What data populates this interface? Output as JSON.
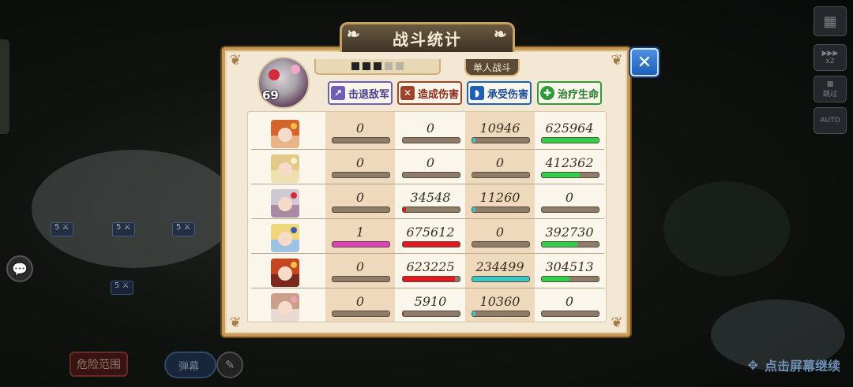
{
  "title": "战斗统计",
  "mode_badge": "单人战斗",
  "player_name_redacted": true,
  "hero_level": "69",
  "close_glyph": "✕",
  "tabs": {
    "kill": {
      "label": "击退敌军",
      "icon": "boot-icon",
      "color": "#6d5fb5"
    },
    "dealt": {
      "label": "造成伤害",
      "icon": "crossed-swords-icon",
      "color": "#a0432b"
    },
    "taken": {
      "label": "承受伤害",
      "icon": "shield-icon",
      "color": "#1e5fb8"
    },
    "heal": {
      "label": "治疗生命",
      "icon": "plus-cross-icon",
      "color": "#2f9a3a"
    }
  },
  "bar_colors": {
    "kill": "#e03fbe",
    "dealt": "#e3161c",
    "taken": "#37c8c9",
    "heal": "#2fd04a"
  },
  "units": [
    {
      "name": "unit-1",
      "portrait": {
        "hair": "#d4642a",
        "acc": "#f2c14a",
        "bg": "#e8b48a"
      },
      "kill": {
        "value": "0",
        "ratio": 0
      },
      "dealt": {
        "value": "0",
        "ratio": 0
      },
      "taken": {
        "value": "10946",
        "ratio": 0.06
      },
      "heal": {
        "value": "625964",
        "ratio": 1.0
      }
    },
    {
      "name": "unit-2",
      "portrait": {
        "hair": "#e3c986",
        "acc": "#f7f1d2",
        "bg": "#efe0b0"
      },
      "kill": {
        "value": "0",
        "ratio": 0
      },
      "dealt": {
        "value": "0",
        "ratio": 0
      },
      "taken": {
        "value": "0",
        "ratio": 0
      },
      "heal": {
        "value": "412362",
        "ratio": 0.66
      }
    },
    {
      "name": "unit-3",
      "portrait": {
        "hair": "#cfc9d3",
        "acc": "#d42a3a",
        "bg": "#a98aa4"
      },
      "kill": {
        "value": "0",
        "ratio": 0
      },
      "dealt": {
        "value": "34548",
        "ratio": 0.05
      },
      "taken": {
        "value": "11260",
        "ratio": 0.06
      },
      "heal": {
        "value": "0",
        "ratio": 0
      }
    },
    {
      "name": "unit-4",
      "portrait": {
        "hair": "#f0d67a",
        "acc": "#3b5fa8",
        "bg": "#9fc2e2"
      },
      "kill": {
        "value": "1",
        "ratio": 1.0
      },
      "dealt": {
        "value": "675612",
        "ratio": 1.0
      },
      "taken": {
        "value": "0",
        "ratio": 0
      },
      "heal": {
        "value": "392730",
        "ratio": 0.62
      }
    },
    {
      "name": "unit-5",
      "portrait": {
        "hair": "#c6461f",
        "acc": "#f2c14a",
        "bg": "#7a2a1c"
      },
      "kill": {
        "value": "0",
        "ratio": 0
      },
      "dealt": {
        "value": "623225",
        "ratio": 0.92
      },
      "taken": {
        "value": "234499",
        "ratio": 1.0
      },
      "heal": {
        "value": "304513",
        "ratio": 0.48
      }
    },
    {
      "name": "unit-6",
      "portrait": {
        "hair": "#caa08a",
        "acc": "#e7a4b4",
        "bg": "#e9d9d2"
      },
      "kill": {
        "value": "0",
        "ratio": 0
      },
      "dealt": {
        "value": "5910",
        "ratio": 0.01
      },
      "taken": {
        "value": "10360",
        "ratio": 0.05
      },
      "heal": {
        "value": "0",
        "ratio": 0
      }
    }
  ],
  "background": {
    "danger_button": "危险范围",
    "toggle_button": "弹幕",
    "continue_hint": "点击屏幕继续",
    "right_buttons": [
      "x2",
      "跳过",
      "AUTO"
    ]
  }
}
